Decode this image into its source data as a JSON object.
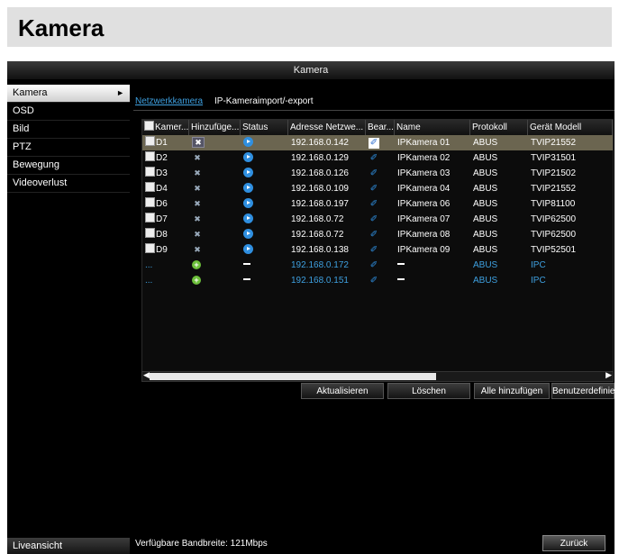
{
  "page": {
    "title": "Kamera"
  },
  "window": {
    "title": "Kamera"
  },
  "sidebar": {
    "items": [
      {
        "label": "Kamera",
        "active": true
      },
      {
        "label": "OSD"
      },
      {
        "label": "Bild"
      },
      {
        "label": "PTZ"
      },
      {
        "label": "Bewegung"
      },
      {
        "label": "Videoverlust"
      }
    ],
    "live_label": "Liveansicht"
  },
  "tabs": {
    "active": "Netzwerkkamera",
    "other": "IP-Kameraimport/-export"
  },
  "table": {
    "headers": [
      "Kamer...",
      "Hinzufüge...",
      "Status",
      "Adresse Netzwe...",
      "Bear...",
      "Name",
      "Protokoll",
      "Gerät Modell"
    ],
    "rows": [
      {
        "cam": "D1",
        "address": "192.168.0.142",
        "name": "IPKamera 01",
        "protocol": "ABUS",
        "model": "TVIP21552"
      },
      {
        "cam": "D2",
        "address": "192.168.0.129",
        "name": "IPKamera 02",
        "protocol": "ABUS",
        "model": "TVIP31501"
      },
      {
        "cam": "D3",
        "address": "192.168.0.126",
        "name": "IPKamera 03",
        "protocol": "ABUS",
        "model": "TVIP21502"
      },
      {
        "cam": "D4",
        "address": "192.168.0.109",
        "name": "IPKamera 04",
        "protocol": "ABUS",
        "model": "TVIP21552"
      },
      {
        "cam": "D6",
        "address": "192.168.0.197",
        "name": "IPKamera 06",
        "protocol": "ABUS",
        "model": "TVIP81100"
      },
      {
        "cam": "D7",
        "address": "192.168.0.72",
        "name": "IPKamera 07",
        "protocol": "ABUS",
        "model": "TVIP62500"
      },
      {
        "cam": "D8",
        "address": "192.168.0.72",
        "name": "IPKamera 08",
        "protocol": "ABUS",
        "model": "TVIP62500"
      },
      {
        "cam": "D9",
        "address": "192.168.0.138",
        "name": "IPKamera 09",
        "protocol": "ABUS",
        "model": "TVIP52501"
      }
    ],
    "discovered": [
      {
        "cam": "...",
        "address": "192.168.0.172",
        "protocol": "ABUS",
        "model": "IPC"
      },
      {
        "cam": "...",
        "address": "192.168.0.151",
        "protocol": "ABUS",
        "model": "IPC"
      }
    ]
  },
  "buttons": {
    "refresh": "Aktualisieren",
    "delete": "Löschen",
    "add_all": "Alle hinzufügen",
    "custom": "Benutzerdefinier..."
  },
  "footer": {
    "bandwidth": "Verfügbare Bandbreite: 121Mbps",
    "back": "Zurück"
  },
  "colors": {
    "accent": "#3ea0e0",
    "selected_row": "#6b6550",
    "background": "#000000"
  }
}
